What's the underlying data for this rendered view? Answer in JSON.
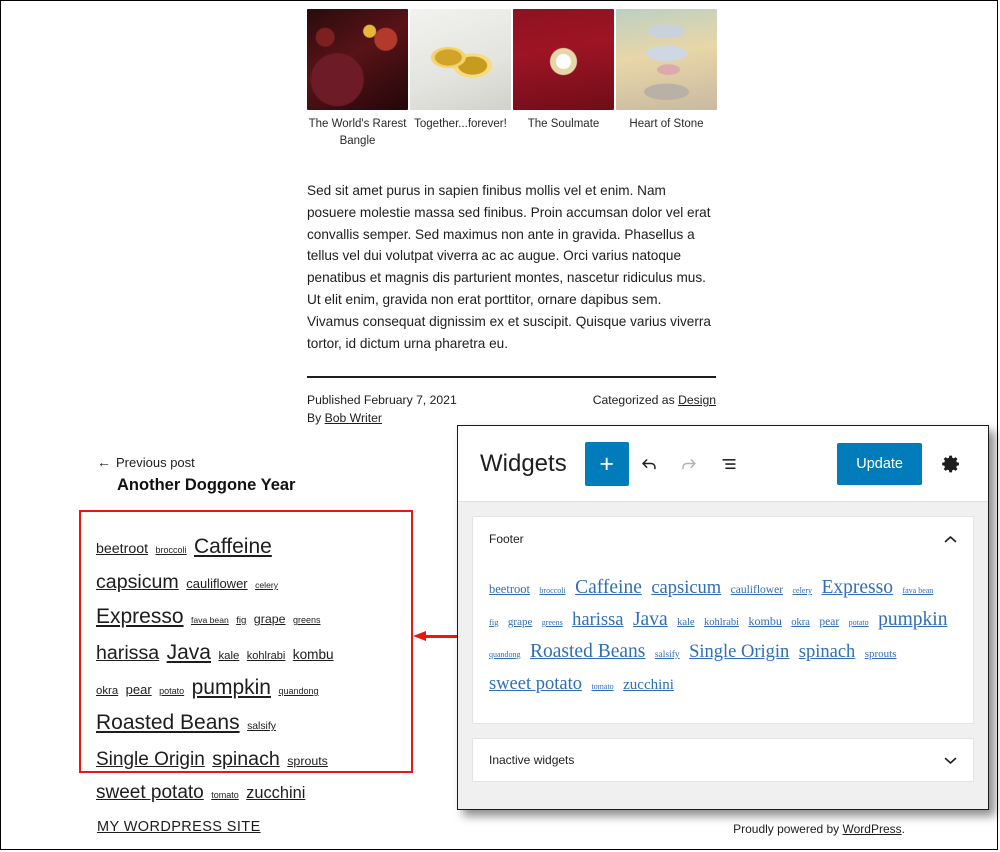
{
  "site": {
    "name": "MY WORDPRESS SITE",
    "credit_prefix": "Proudly powered by ",
    "credit_link": "WordPress",
    "credit_suffix": "."
  },
  "post": {
    "gallery": [
      {
        "caption": "The World's Rarest Bangle",
        "thumb": "ring-thumb"
      },
      {
        "caption": "Together...forever!",
        "thumb": "wedding-rings-thumb"
      },
      {
        "caption": "The Soulmate",
        "thumb": "bracelet-thumb"
      },
      {
        "caption": "Heart of Stone",
        "thumb": "heart-pendant-thumb"
      }
    ],
    "body": "Sed sit amet purus in sapien finibus mollis vel et enim. Nam posuere molestie massa sed finibus. Proin accumsan dolor vel erat convallis semper. Sed maximus non ante in gravida. Phasellus a tellus vel dui volutpat viverra ac ac augue. Orci varius natoque penatibus et magnis dis parturient montes, nascetur ridiculus mus. Ut elit enim, gravida non erat porttitor, ornare dapibus sem. Vivamus consequat dignissim ex et suscipit. Quisque varius viverra tortor, id dictum urna pharetra eu.",
    "published_label": "Published February 7, 2021",
    "by_label": "By ",
    "author": "Bob Writer",
    "categorized_label": "Categorized as ",
    "category": "Design",
    "prev_label": "Previous post",
    "prev_arrow": "←",
    "prev_title": "Another Doggone Year"
  },
  "tag_cloud": {
    "tags": [
      {
        "label": "beetroot",
        "size": 14.2
      },
      {
        "label": "broccoli",
        "size": 9.0
      },
      {
        "label": "Caffeine",
        "size": 21.0
      },
      {
        "label": "capsicum",
        "size": 19.6
      },
      {
        "label": "cauliflower",
        "size": 13.0
      },
      {
        "label": "celery",
        "size": 8.6
      },
      {
        "label": "Expresso",
        "size": 21.0
      },
      {
        "label": "fava bean",
        "size": 8.6
      },
      {
        "label": "fig",
        "size": 9.6
      },
      {
        "label": "grape",
        "size": 12.4
      },
      {
        "label": "greens",
        "size": 9.0
      },
      {
        "label": "harissa",
        "size": 19.6
      },
      {
        "label": "Java",
        "size": 21.0
      },
      {
        "label": "kale",
        "size": 11.4
      },
      {
        "label": "kohlrabi",
        "size": 11.0
      },
      {
        "label": "kombu",
        "size": 13.6
      },
      {
        "label": "okra",
        "size": 11.4
      },
      {
        "label": "pear",
        "size": 13.0
      },
      {
        "label": "potato",
        "size": 9.0
      },
      {
        "label": "pumpkin",
        "size": 21.0
      },
      {
        "label": "quandong",
        "size": 9.0
      },
      {
        "label": "Roasted Beans",
        "size": 21.0
      },
      {
        "label": "salsify",
        "size": 10.4
      },
      {
        "label": "Single Origin",
        "size": 19.0
      },
      {
        "label": "spinach",
        "size": 19.6
      },
      {
        "label": "sprouts",
        "size": 12.4
      },
      {
        "label": "sweet potato",
        "size": 19.0
      },
      {
        "label": "tomato",
        "size": 9.0
      },
      {
        "label": "zucchini",
        "size": 16.4
      }
    ]
  },
  "admin_tag_cloud": {
    "tags": [
      {
        "label": "beetroot",
        "size": 12.5
      },
      {
        "label": "broccoli",
        "size": 8.0
      },
      {
        "label": "Caffeine",
        "size": 19.5
      },
      {
        "label": "capsicum",
        "size": 18.5
      },
      {
        "label": "cauliflower",
        "size": 11.5
      },
      {
        "label": "celery",
        "size": 8.0
      },
      {
        "label": "Expresso",
        "size": 19.5
      },
      {
        "label": "fava bean",
        "size": 8.0
      },
      {
        "label": "fig",
        "size": 8.5
      },
      {
        "label": "grape",
        "size": 11.0
      },
      {
        "label": "greens",
        "size": 8.0
      },
      {
        "label": "harissa",
        "size": 18.5
      },
      {
        "label": "Java",
        "size": 19.5
      },
      {
        "label": "kale",
        "size": 10.5
      },
      {
        "label": "kohlrabi",
        "size": 10.5
      },
      {
        "label": "kombu",
        "size": 12.0
      },
      {
        "label": "okra",
        "size": 10.5
      },
      {
        "label": "pear",
        "size": 11.5
      },
      {
        "label": "potato",
        "size": 8.0
      },
      {
        "label": "pumpkin",
        "size": 19.5
      },
      {
        "label": "quandong",
        "size": 8.0
      },
      {
        "label": "Roasted Beans",
        "size": 19.5
      },
      {
        "label": "salsify",
        "size": 9.5
      },
      {
        "label": "Single Origin",
        "size": 18.5
      },
      {
        "label": "spinach",
        "size": 18.5
      },
      {
        "label": "sprouts",
        "size": 11.0
      },
      {
        "label": "sweet potato",
        "size": 18.5
      },
      {
        "label": "tomato",
        "size": 8.0
      },
      {
        "label": "zucchini",
        "size": 15.0
      }
    ]
  },
  "widgets_panel": {
    "title": "Widgets",
    "add_button": "+",
    "undo_icon": "undo-icon",
    "redo_icon": "redo-icon",
    "list_view_icon": "list-view-icon",
    "update_button": "Update",
    "settings_icon": "gear-icon",
    "areas": [
      {
        "name": "Footer",
        "chevron": "⌃",
        "expanded": true
      },
      {
        "name": "Inactive widgets",
        "chevron": "⌄",
        "expanded": false
      }
    ]
  },
  "annotation": {
    "highlight_color": "#e8170f",
    "arrow_direction": "left"
  }
}
